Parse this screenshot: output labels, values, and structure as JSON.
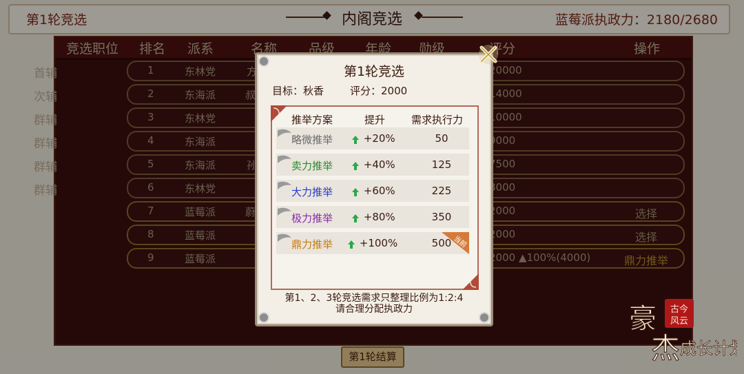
{
  "header": {
    "round_label": "第1轮竞选",
    "page_title": "内阁竞选",
    "exec_power": "蓝莓派执政力：2180/2680"
  },
  "table": {
    "columns": [
      "竞选职位",
      "排名",
      "派系",
      "名称",
      "品级",
      "年龄",
      "勋级",
      "评分",
      "操作"
    ],
    "rows": [
      {
        "position": "首辅",
        "rank": "1",
        "faction": "东林党",
        "name_part": "方",
        "score_part": "20000",
        "op": ""
      },
      {
        "position": "次辅",
        "rank": "2",
        "faction": "东海派",
        "name_part": "叔",
        "score_part": "14000",
        "op": ""
      },
      {
        "position": "群辅",
        "rank": "3",
        "faction": "东林党",
        "name_part": "",
        "score_part": "10000",
        "op": ""
      },
      {
        "position": "群辅",
        "rank": "4",
        "faction": "东海派",
        "name_part": "",
        "score_part": "9000",
        "op": ""
      },
      {
        "position": "群辅",
        "rank": "5",
        "faction": "东海派",
        "name_part": "孙",
        "score_part": "7500",
        "op": ""
      },
      {
        "position": "群辅",
        "rank": "6",
        "faction": "东林党",
        "name_part": "",
        "score_part": "8000",
        "op": ""
      },
      {
        "position": "",
        "rank": "7",
        "faction": "蓝莓派",
        "name_part": "蔚",
        "score_part": "2000",
        "op": "选择"
      },
      {
        "position": "",
        "rank": "8",
        "faction": "蓝莓派",
        "name_part": "",
        "score_part": "2000",
        "op": "选择"
      },
      {
        "position": "",
        "rank": "9",
        "faction": "蓝莓派",
        "name_part": "",
        "score_part": "2000 ▲100%(4000)",
        "op": "鼎力推举"
      }
    ]
  },
  "settle_button": "第1轮结算",
  "modal": {
    "title": "第1轮竞选",
    "target": "目标：秋香",
    "score": "评分：2000",
    "columns": [
      "推举方案",
      "提升",
      "需求执行力"
    ],
    "options": [
      {
        "name": "略微推举",
        "rise": "+20%",
        "need": "50",
        "color": "#6a6a6a"
      },
      {
        "name": "卖力推举",
        "rise": "+40%",
        "need": "125",
        "color": "#2a8a2a"
      },
      {
        "name": "大力推举",
        "rise": "+60%",
        "need": "225",
        "color": "#2a3ac8"
      },
      {
        "name": "极力推举",
        "rise": "+80%",
        "need": "350",
        "color": "#8a2aa8"
      },
      {
        "name": "鼎力推举",
        "rise": "+100%",
        "need": "500",
        "color": "#c87a10"
      }
    ],
    "current_badge": "当前",
    "note_line1": "第1、2、3轮竞选需求只整理比例为1:2:4",
    "note_line2": "请合理分配执政力"
  },
  "logo": {
    "main": "豪杰成长计划",
    "seal": "古今风云"
  }
}
